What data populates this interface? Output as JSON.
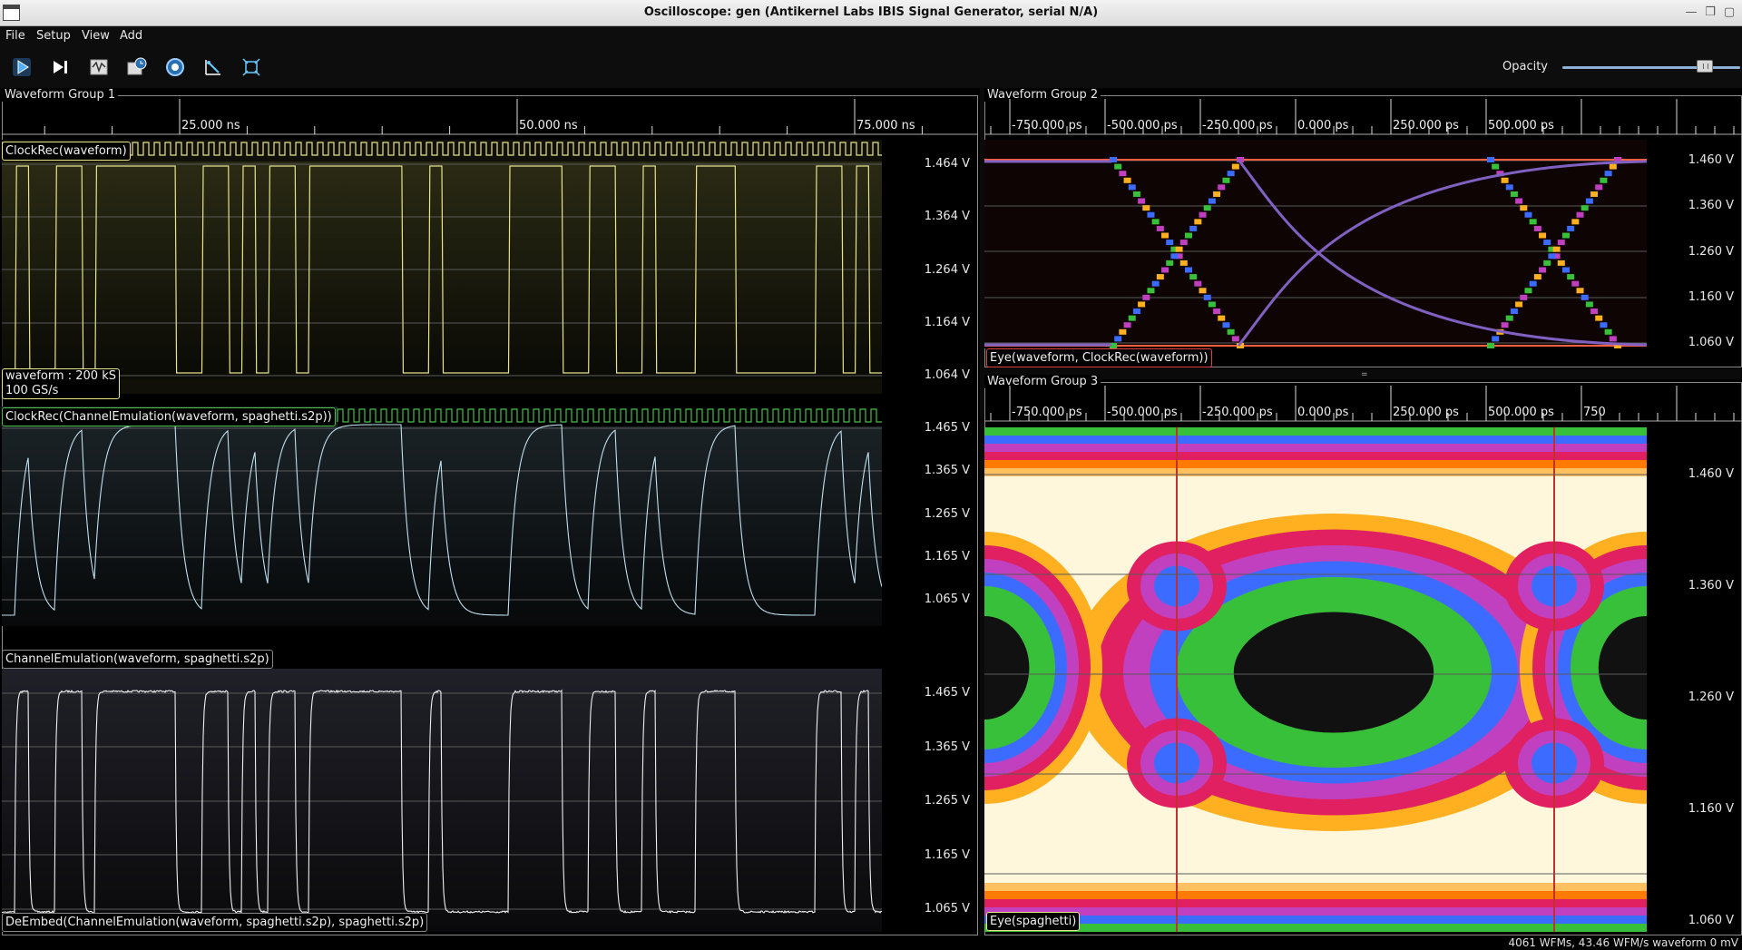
{
  "window": {
    "title": "Oscilloscope: gen (Antikernel Labs IBIS Signal Generator, serial N/A)"
  },
  "menu": [
    "File",
    "Setup",
    "View",
    "Add"
  ],
  "toolbar": {
    "buttons": [
      {
        "name": "start-trigger-button",
        "icon": "play-icon"
      },
      {
        "name": "single-trigger-button",
        "icon": "step-icon"
      },
      {
        "name": "force-trigger-button",
        "icon": "waveform-icon"
      },
      {
        "name": "history-button",
        "icon": "clock-icon"
      },
      {
        "name": "refresh-button",
        "icon": "refresh-icon"
      },
      {
        "name": "quick-scale-button",
        "icon": "scale-icon"
      },
      {
        "name": "fullscreen-button",
        "icon": "fullscreen-icon"
      }
    ],
    "opacity_label": "Opacity",
    "opacity_value": 0.83
  },
  "group1": {
    "title": "Waveform Group 1",
    "time_ticks": [
      "25.000 ns",
      "50.000 ns",
      "75.000 ns"
    ],
    "plots": [
      {
        "label": "ClockRec(waveform)",
        "volts": [
          "1.464 V",
          "1.364 V",
          "1.264 V",
          "1.164 V",
          "1.064 V"
        ],
        "info_line1": "waveform : 200 kS",
        "info_line2": "100 GS/s",
        "color": "#e8e48a"
      },
      {
        "label": "ClockRec(ChannelEmulation(waveform, spaghetti.s2p))",
        "sub_label": "ChannelEmulation(waveform, spaghetti.s2p)",
        "volts": [
          "1.465 V",
          "1.365 V",
          "1.265 V",
          "1.165 V",
          "1.065 V"
        ],
        "color": "#bfe0f0"
      },
      {
        "label": "DeEmbed(ChannelEmulation(waveform, spaghetti.s2p), spaghetti.s2p)",
        "volts": [
          "1.465 V",
          "1.365 V",
          "1.265 V",
          "1.165 V",
          "1.065 V"
        ],
        "color": "#f0f0f0"
      }
    ]
  },
  "group2": {
    "title": "Waveform Group 2",
    "time_ticks": [
      "-750.000 ps",
      "-500.000 ps",
      "-250.000 ps",
      "0.000 ps",
      "250.000 ps",
      "500.000 ps"
    ],
    "volts": [
      "1.460 V",
      "1.360 V",
      "1.260 V",
      "1.160 V",
      "1.060 V"
    ],
    "label": "Eye(waveform, ClockRec(waveform))"
  },
  "group3": {
    "title": "Waveform Group 3",
    "time_ticks": [
      "-750.000 ps",
      "-500.000 ps",
      "-250.000 ps",
      "0.000 ps",
      "250.000 ps",
      "500.000 ps",
      "750"
    ],
    "volts": [
      "1.460 V",
      "1.360 V",
      "1.260 V",
      "1.160 V",
      "1.060 V"
    ],
    "label": "Eye(spaghetti)"
  },
  "status": {
    "text": "4061 WFMs, 43.46 WFM/s  waveform 0 mV"
  }
}
